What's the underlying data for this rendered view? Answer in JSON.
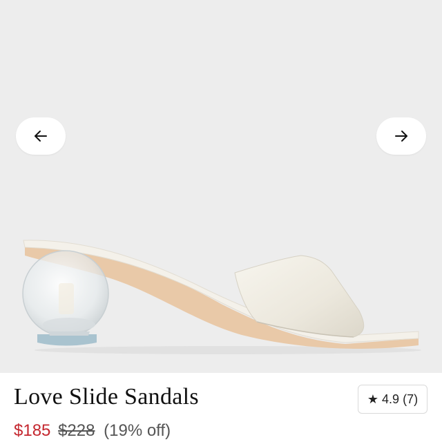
{
  "gallery": {
    "prev_icon": "arrow-left-icon",
    "next_icon": "arrow-right-icon"
  },
  "product": {
    "title": "Love Slide Sandals",
    "rating_star": "★",
    "rating_value": "4.9",
    "rating_count": "(7)",
    "price_current": "$185",
    "price_original": "$228",
    "discount": "(19% off)"
  },
  "colors": {
    "sale_price": "#c4262e",
    "background": "#ededed"
  }
}
